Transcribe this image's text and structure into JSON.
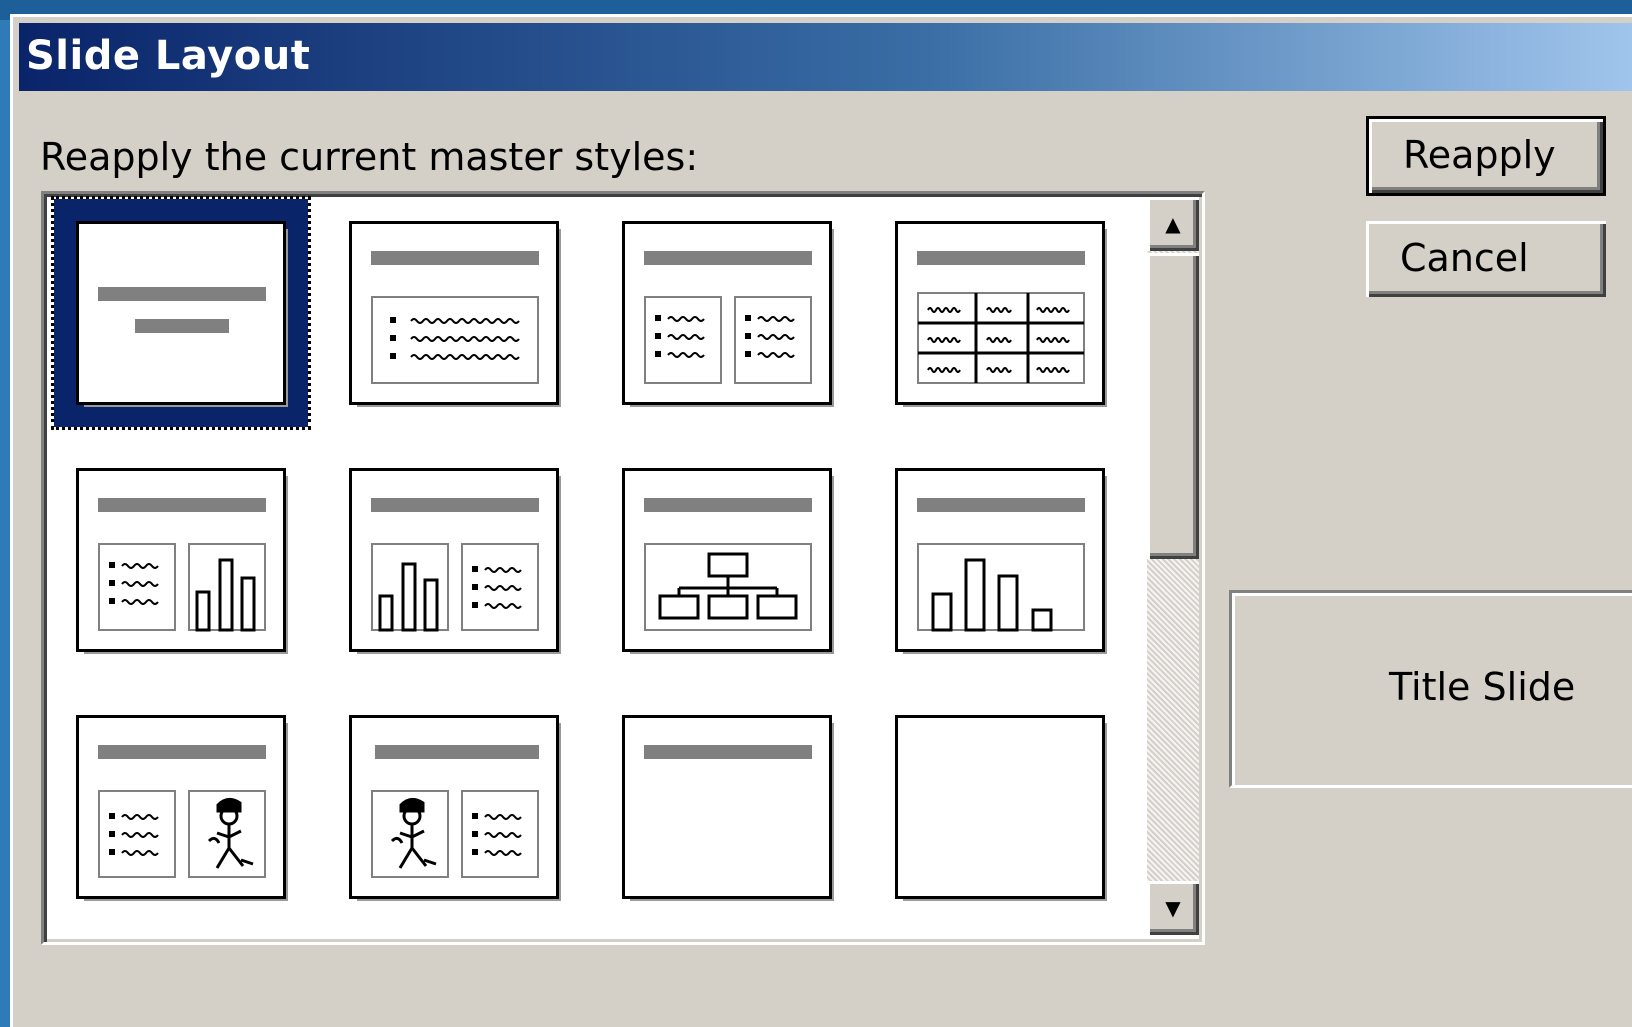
{
  "dialog": {
    "title": "Slide Layout",
    "prompt": "Reapply the current master styles:",
    "buttons": {
      "reapply": "Reapply",
      "cancel": "Cancel"
    },
    "preview_caption": "Title Slide",
    "selected_layout": "title-slide"
  },
  "layouts": [
    {
      "id": "title-slide"
    },
    {
      "id": "bulleted-list"
    },
    {
      "id": "two-column-text"
    },
    {
      "id": "table"
    },
    {
      "id": "text-and-chart"
    },
    {
      "id": "chart-and-text"
    },
    {
      "id": "organization-chart"
    },
    {
      "id": "chart"
    },
    {
      "id": "text-and-clip-art"
    },
    {
      "id": "clip-art-and-text"
    },
    {
      "id": "title-only"
    },
    {
      "id": "blank"
    }
  ],
  "scrollbar": {
    "up_icon": "arrow-up-icon",
    "down_icon": "arrow-down-icon"
  }
}
